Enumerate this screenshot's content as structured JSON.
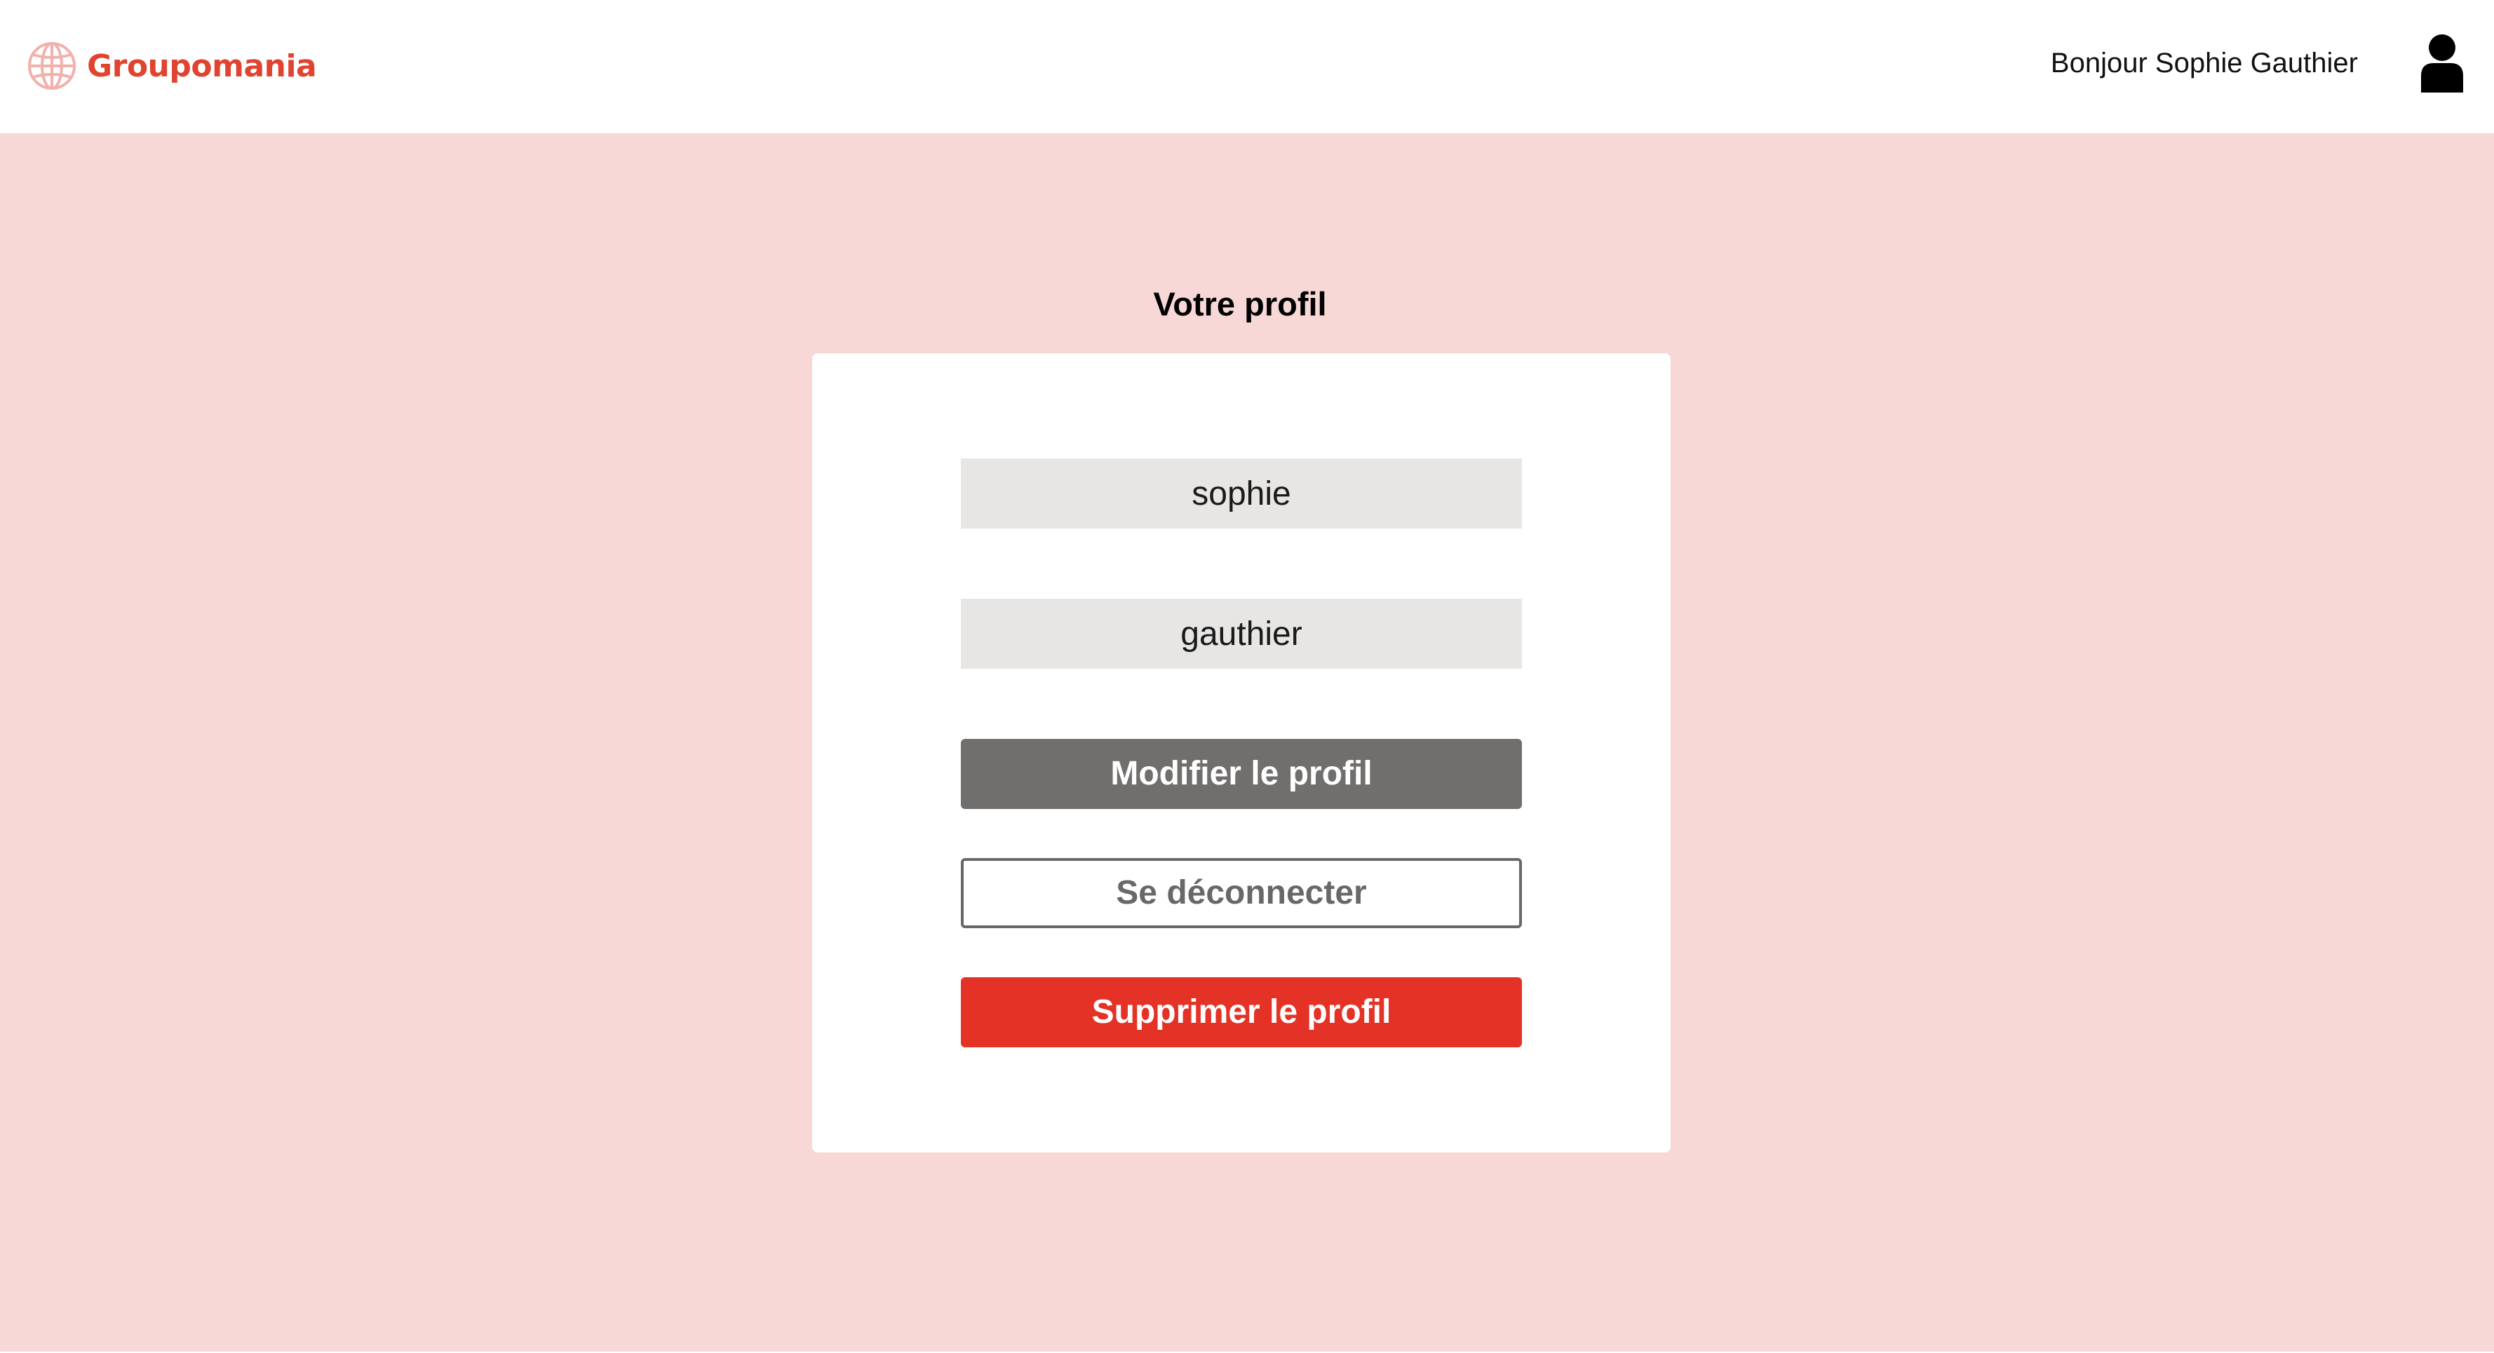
{
  "header": {
    "brand_name": "Groupomania",
    "greeting": "Bonjour Sophie Gauthier",
    "logo_icon": "globe-icon",
    "avatar_icon": "user-icon"
  },
  "profile": {
    "title": "Votre profil",
    "first_name_value": "sophie",
    "last_name_value": "gauthier",
    "edit_label": "Modifier le profil",
    "logout_label": "Se déconnecter",
    "delete_label": "Supprimer le profil"
  },
  "colors": {
    "page_background": "#f7d8d7",
    "brand_red": "#e0432f",
    "edit_button": "#716f6d",
    "delete_button": "#e53226",
    "field_background": "#e7e6e5"
  }
}
